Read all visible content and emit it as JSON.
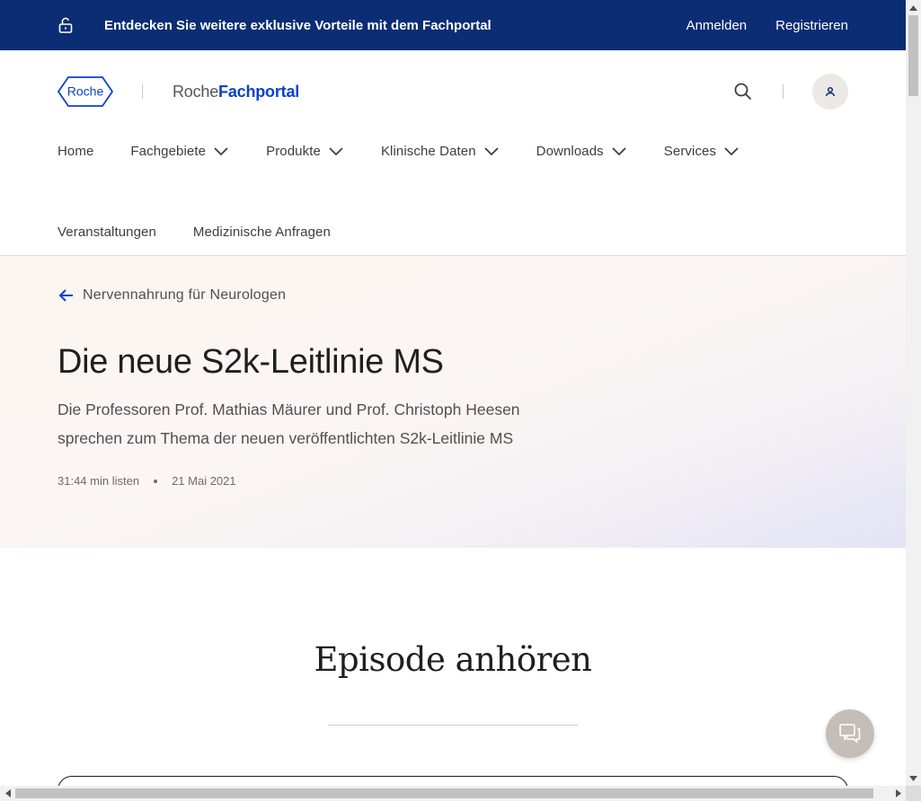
{
  "banner": {
    "promo": "Entdecken Sie weitere exklusive Vorteile mit dem Fachportal",
    "login": "Anmelden",
    "register": "Registrieren",
    "icon": "unlock-icon",
    "background": "#0b2d74"
  },
  "header": {
    "logo_text": "Roche",
    "brand_prefix": "Roche",
    "brand_suffix": "Fachportal",
    "brand_color": "#0b41cd",
    "search_icon": "search-icon",
    "user_icon": "user-icon"
  },
  "nav": {
    "row1": [
      {
        "label": "Home",
        "has_dropdown": false
      },
      {
        "label": "Fachgebiete",
        "has_dropdown": true
      },
      {
        "label": "Produkte",
        "has_dropdown": true
      },
      {
        "label": "Klinische Daten",
        "has_dropdown": true
      },
      {
        "label": "Downloads",
        "has_dropdown": true
      },
      {
        "label": "Services",
        "has_dropdown": true
      }
    ],
    "row2": [
      {
        "label": "Veranstaltungen"
      },
      {
        "label": "Medizinische Anfragen"
      }
    ]
  },
  "hero": {
    "back_label": "Nervennahrung für Neurologen",
    "title": "Die neue S2k-Leitlinie MS",
    "subtitle": "Die Professoren Prof. Mathias Mäurer und Prof. Christoph Heesen sprechen zum Thema der neuen veröffentlichten S2k-Leitlinie MS",
    "duration": "31:44 min listen",
    "date": "21 Mai 2021"
  },
  "episode": {
    "title": "Episode anhören"
  },
  "chat": {
    "icon": "chat-icon"
  }
}
